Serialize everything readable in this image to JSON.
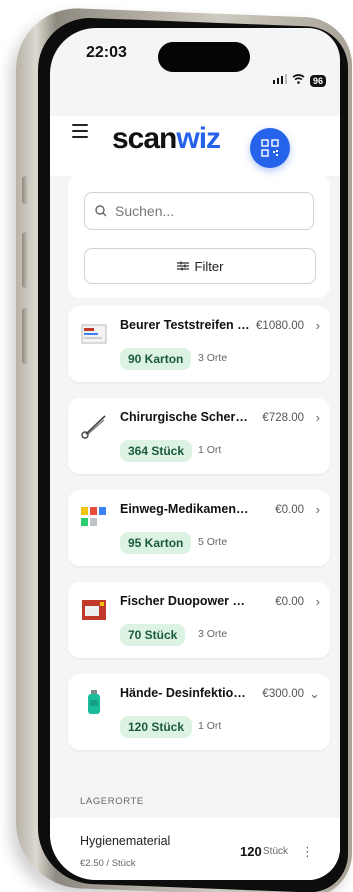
{
  "status": {
    "time": "22:03",
    "battery": "96"
  },
  "brand": {
    "logo_a": "scan",
    "logo_b": "wiz"
  },
  "search": {
    "placeholder": "Suchen..."
  },
  "filter": {
    "label": "Filter"
  },
  "products": [
    {
      "name": "Beurer Teststreifen zu...",
      "price": "€1080.00",
      "qty": "90 Karton",
      "locations": "3 Orte",
      "chevron": "›",
      "thumb": "box-icon"
    },
    {
      "name": "Chirurgische Schere g...",
      "price": "€728.00",
      "qty": "364 Stück",
      "locations": "1 Ort",
      "chevron": "›",
      "thumb": "scissors-icon"
    },
    {
      "name": "Einweg-Medikamentenbe...",
      "price": "€0.00",
      "qty": "95 Karton",
      "locations": "5 Orte",
      "chevron": "›",
      "thumb": "cups-icon"
    },
    {
      "name": "Fischer Duopower Dübel-...",
      "price": "€0.00",
      "qty": "70 Stück",
      "locations": "3 Orte",
      "chevron": "›",
      "thumb": "package-icon"
    },
    {
      "name": "Hände- Desinfektions...",
      "price": "€300.00",
      "qty": "120 Stück",
      "locations": "1 Ort",
      "chevron": "⌄",
      "thumb": "bottle-icon"
    }
  ],
  "locations_section": {
    "title": "LAGERORTE"
  },
  "location_row": {
    "title": "Hygienematerial",
    "sub": "€2.50 / Stück",
    "qty": "120",
    "unit": "Stück"
  },
  "colors": {
    "accent": "#2563eb",
    "badge_bg": "#dcf3e4",
    "badge_fg": "#1c5b36"
  }
}
